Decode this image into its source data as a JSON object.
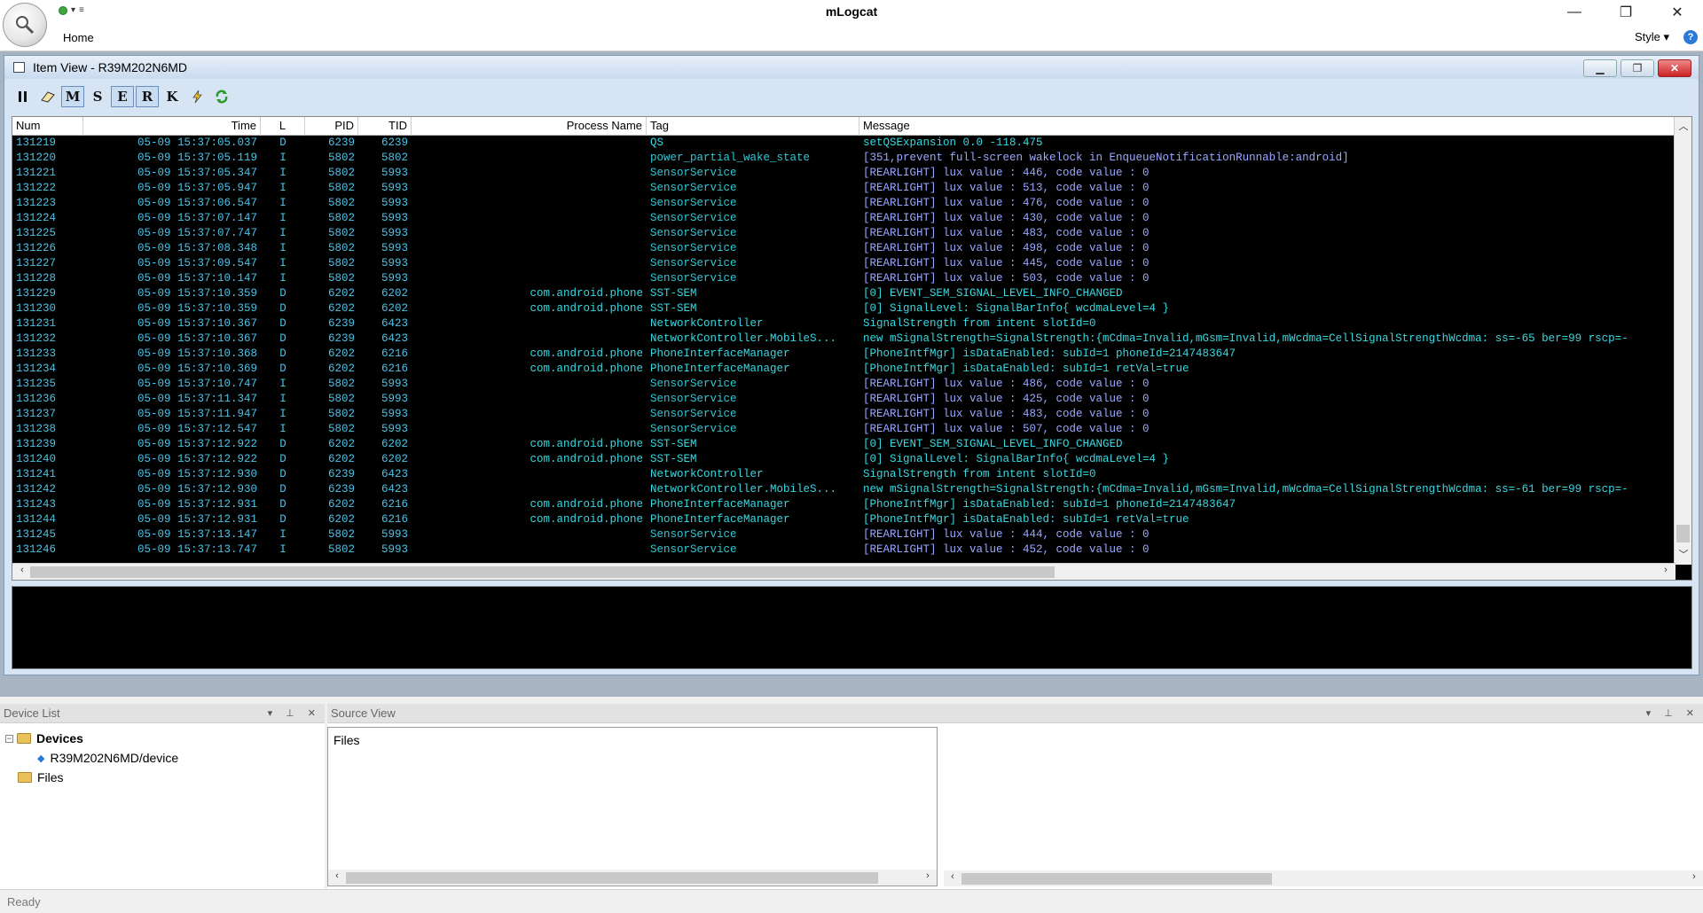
{
  "app": {
    "title": "mLogcat",
    "ribbon_tab": "Home",
    "style_menu": "Style ▾",
    "help": "?"
  },
  "item_view": {
    "title": "Item View - R39M202N6MD",
    "toolbar": [
      "M",
      "S",
      "E",
      "R",
      "K"
    ],
    "columns": [
      "Num",
      "Time",
      "L",
      "PID",
      "TID",
      "Process Name",
      "Tag",
      "Message"
    ],
    "rows": [
      {
        "num": "131219",
        "time": "05-09 15:37:05.037",
        "lvl": "D",
        "pid": "6239",
        "tid": "6239",
        "proc": "",
        "tag": "QS",
        "msg": "setQSExpansion 0.0 -118.475"
      },
      {
        "num": "131220",
        "time": "05-09 15:37:05.119",
        "lvl": "I",
        "pid": "5802",
        "tid": "5802",
        "proc": "",
        "tag": "power_partial_wake_state",
        "msg": "[351,prevent full-screen wakelock in EnqueueNotificationRunnable:android]"
      },
      {
        "num": "131221",
        "time": "05-09 15:37:05.347",
        "lvl": "I",
        "pid": "5802",
        "tid": "5993",
        "proc": "",
        "tag": "SensorService",
        "msg": "[REARLIGHT] lux value : 446, code value : 0"
      },
      {
        "num": "131222",
        "time": "05-09 15:37:05.947",
        "lvl": "I",
        "pid": "5802",
        "tid": "5993",
        "proc": "",
        "tag": "SensorService",
        "msg": "[REARLIGHT] lux value : 513, code value : 0"
      },
      {
        "num": "131223",
        "time": "05-09 15:37:06.547",
        "lvl": "I",
        "pid": "5802",
        "tid": "5993",
        "proc": "",
        "tag": "SensorService",
        "msg": "[REARLIGHT] lux value : 476, code value : 0"
      },
      {
        "num": "131224",
        "time": "05-09 15:37:07.147",
        "lvl": "I",
        "pid": "5802",
        "tid": "5993",
        "proc": "",
        "tag": "SensorService",
        "msg": "[REARLIGHT] lux value : 430, code value : 0"
      },
      {
        "num": "131225",
        "time": "05-09 15:37:07.747",
        "lvl": "I",
        "pid": "5802",
        "tid": "5993",
        "proc": "",
        "tag": "SensorService",
        "msg": "[REARLIGHT] lux value : 483, code value : 0"
      },
      {
        "num": "131226",
        "time": "05-09 15:37:08.348",
        "lvl": "I",
        "pid": "5802",
        "tid": "5993",
        "proc": "",
        "tag": "SensorService",
        "msg": "[REARLIGHT] lux value : 498, code value : 0"
      },
      {
        "num": "131227",
        "time": "05-09 15:37:09.547",
        "lvl": "I",
        "pid": "5802",
        "tid": "5993",
        "proc": "",
        "tag": "SensorService",
        "msg": "[REARLIGHT] lux value : 445, code value : 0"
      },
      {
        "num": "131228",
        "time": "05-09 15:37:10.147",
        "lvl": "I",
        "pid": "5802",
        "tid": "5993",
        "proc": "",
        "tag": "SensorService",
        "msg": "[REARLIGHT] lux value : 503, code value : 0"
      },
      {
        "num": "131229",
        "time": "05-09 15:37:10.359",
        "lvl": "D",
        "pid": "6202",
        "tid": "6202",
        "proc": "com.android.phone",
        "tag": "SST-SEM",
        "msg": "[0] EVENT_SEM_SIGNAL_LEVEL_INFO_CHANGED"
      },
      {
        "num": "131230",
        "time": "05-09 15:37:10.359",
        "lvl": "D",
        "pid": "6202",
        "tid": "6202",
        "proc": "com.android.phone",
        "tag": "SST-SEM",
        "msg": "[0] SignalLevel: SignalBarInfo{ wcdmaLevel=4 }"
      },
      {
        "num": "131231",
        "time": "05-09 15:37:10.367",
        "lvl": "D",
        "pid": "6239",
        "tid": "6423",
        "proc": "",
        "tag": "NetworkController",
        "msg": "SignalStrength from intent slotId=0"
      },
      {
        "num": "131232",
        "time": "05-09 15:37:10.367",
        "lvl": "D",
        "pid": "6239",
        "tid": "6423",
        "proc": "",
        "tag": "NetworkController.MobileS...",
        "msg": "new mSignalStrength=SignalStrength:{mCdma=Invalid,mGsm=Invalid,mWcdma=CellSignalStrengthWcdma: ss=-65 ber=99 rscp=-"
      },
      {
        "num": "131233",
        "time": "05-09 15:37:10.368",
        "lvl": "D",
        "pid": "6202",
        "tid": "6216",
        "proc": "com.android.phone",
        "tag": "PhoneInterfaceManager",
        "msg": "[PhoneIntfMgr] isDataEnabled: subId=1 phoneId=2147483647"
      },
      {
        "num": "131234",
        "time": "05-09 15:37:10.369",
        "lvl": "D",
        "pid": "6202",
        "tid": "6216",
        "proc": "com.android.phone",
        "tag": "PhoneInterfaceManager",
        "msg": "[PhoneIntfMgr] isDataEnabled: subId=1 retVal=true"
      },
      {
        "num": "131235",
        "time": "05-09 15:37:10.747",
        "lvl": "I",
        "pid": "5802",
        "tid": "5993",
        "proc": "",
        "tag": "SensorService",
        "msg": "[REARLIGHT] lux value : 486, code value : 0"
      },
      {
        "num": "131236",
        "time": "05-09 15:37:11.347",
        "lvl": "I",
        "pid": "5802",
        "tid": "5993",
        "proc": "",
        "tag": "SensorService",
        "msg": "[REARLIGHT] lux value : 425, code value : 0"
      },
      {
        "num": "131237",
        "time": "05-09 15:37:11.947",
        "lvl": "I",
        "pid": "5802",
        "tid": "5993",
        "proc": "",
        "tag": "SensorService",
        "msg": "[REARLIGHT] lux value : 483, code value : 0"
      },
      {
        "num": "131238",
        "time": "05-09 15:37:12.547",
        "lvl": "I",
        "pid": "5802",
        "tid": "5993",
        "proc": "",
        "tag": "SensorService",
        "msg": "[REARLIGHT] lux value : 507, code value : 0"
      },
      {
        "num": "131239",
        "time": "05-09 15:37:12.922",
        "lvl": "D",
        "pid": "6202",
        "tid": "6202",
        "proc": "com.android.phone",
        "tag": "SST-SEM",
        "msg": "[0] EVENT_SEM_SIGNAL_LEVEL_INFO_CHANGED"
      },
      {
        "num": "131240",
        "time": "05-09 15:37:12.922",
        "lvl": "D",
        "pid": "6202",
        "tid": "6202",
        "proc": "com.android.phone",
        "tag": "SST-SEM",
        "msg": "[0] SignalLevel: SignalBarInfo{ wcdmaLevel=4 }"
      },
      {
        "num": "131241",
        "time": "05-09 15:37:12.930",
        "lvl": "D",
        "pid": "6239",
        "tid": "6423",
        "proc": "",
        "tag": "NetworkController",
        "msg": "SignalStrength from intent slotId=0"
      },
      {
        "num": "131242",
        "time": "05-09 15:37:12.930",
        "lvl": "D",
        "pid": "6239",
        "tid": "6423",
        "proc": "",
        "tag": "NetworkController.MobileS...",
        "msg": "new mSignalStrength=SignalStrength:{mCdma=Invalid,mGsm=Invalid,mWcdma=CellSignalStrengthWcdma: ss=-61 ber=99 rscp=-"
      },
      {
        "num": "131243",
        "time": "05-09 15:37:12.931",
        "lvl": "D",
        "pid": "6202",
        "tid": "6216",
        "proc": "com.android.phone",
        "tag": "PhoneInterfaceManager",
        "msg": "[PhoneIntfMgr] isDataEnabled: subId=1 phoneId=2147483647"
      },
      {
        "num": "131244",
        "time": "05-09 15:37:12.931",
        "lvl": "D",
        "pid": "6202",
        "tid": "6216",
        "proc": "com.android.phone",
        "tag": "PhoneInterfaceManager",
        "msg": "[PhoneIntfMgr] isDataEnabled: subId=1 retVal=true"
      },
      {
        "num": "131245",
        "time": "05-09 15:37:13.147",
        "lvl": "I",
        "pid": "5802",
        "tid": "5993",
        "proc": "",
        "tag": "SensorService",
        "msg": "[REARLIGHT] lux value : 444, code value : 0"
      },
      {
        "num": "131246",
        "time": "05-09 15:37:13.747",
        "lvl": "I",
        "pid": "5802",
        "tid": "5993",
        "proc": "",
        "tag": "SensorService",
        "msg": "[REARLIGHT] lux value : 452, code value : 0"
      }
    ]
  },
  "device_list": {
    "title": "Device List",
    "root": "Devices",
    "device": "R39M202N6MD/device",
    "files": "Files"
  },
  "source_view": {
    "title": "Source View",
    "files_label": "Files"
  },
  "status": {
    "text": "Ready"
  },
  "colors": {
    "log_background": "#000000",
    "text_cyan": "#2fd0d6",
    "text_message": "#8ab4ff"
  }
}
